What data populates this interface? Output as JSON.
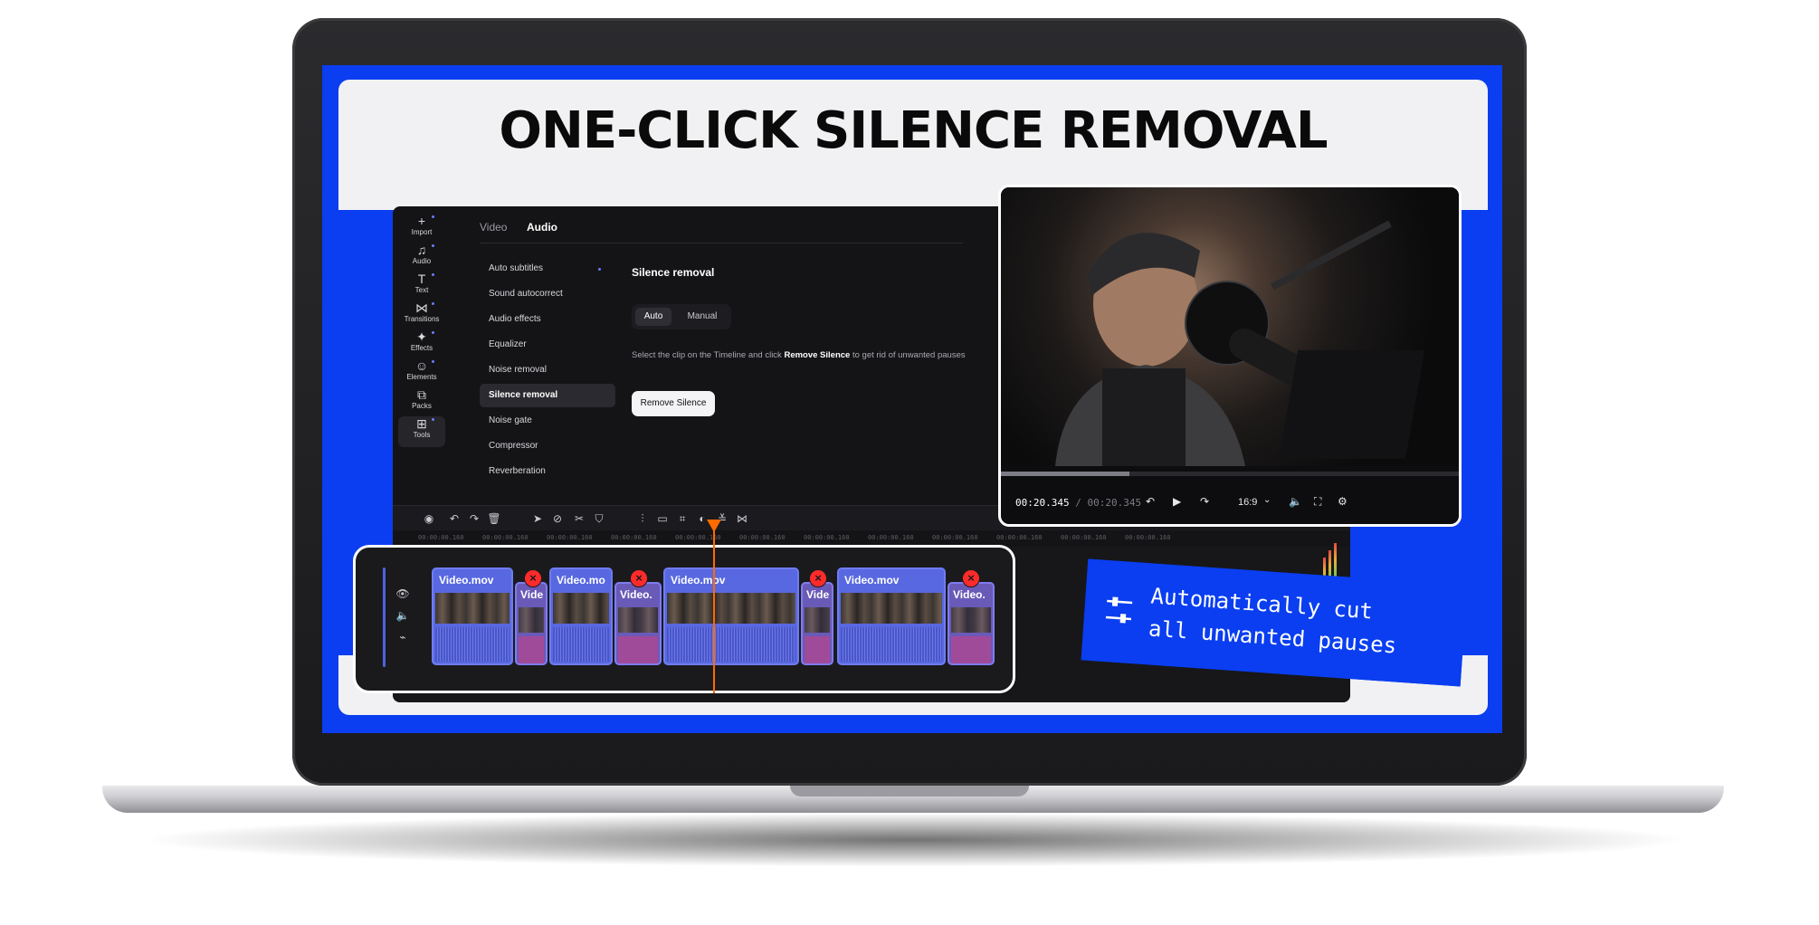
{
  "headline": "ONE-CLICK SILENCE REMOVAL",
  "rail": [
    {
      "label": "Import",
      "icon": "plus-icon"
    },
    {
      "label": "Audio",
      "icon": "music-note-icon"
    },
    {
      "label": "Text",
      "icon": "text-icon"
    },
    {
      "label": "Transitions",
      "icon": "transitions-icon"
    },
    {
      "label": "Effects",
      "icon": "effects-sparkle-icon"
    },
    {
      "label": "Elements",
      "icon": "smiley-icon"
    },
    {
      "label": "Packs",
      "icon": "packs-icon"
    },
    {
      "label": "Tools",
      "icon": "tools-grid-icon"
    }
  ],
  "tabs": {
    "video": "Video",
    "audio": "Audio"
  },
  "menu": [
    "Auto subtitles",
    "Sound autocorrect",
    "Audio effects",
    "Equalizer",
    "Noise removal",
    "Silence removal",
    "Noise gate",
    "Compressor",
    "Reverberation"
  ],
  "panel": {
    "title": "Silence removal",
    "mode_auto": "Auto",
    "mode_manual": "Manual",
    "instruction_pre": "Select the clip on the Timeline and click ",
    "instruction_bold": "Remove Silence",
    "instruction_post": " to get rid of unwanted pauses",
    "button": "Remove Silence"
  },
  "ruler_ticks": [
    "00:00:00.160",
    "00:00:00.160",
    "00:00:00.160",
    "00:00:00.160",
    "00:00:00.160",
    "00:00:00.160",
    "00:00:00.160",
    "00:00:00.160",
    "00:00:00.160",
    "00:00:00.160",
    "00:00:00.160",
    "00:00:00.160"
  ],
  "preview": {
    "time_current": "00:20.345",
    "time_sep": "/",
    "time_total": "00:20.345",
    "aspect": "16:9",
    "progress": 0.28
  },
  "clips": [
    {
      "label": "Video.mov",
      "kind": "keep"
    },
    {
      "label": "Vide",
      "kind": "cut"
    },
    {
      "label": "Video.mo",
      "kind": "keep"
    },
    {
      "label": "Video.",
      "kind": "cut"
    },
    {
      "label": "Video.mov",
      "kind": "keep"
    },
    {
      "label": "Vide",
      "kind": "cut"
    },
    {
      "label": "Video.mov",
      "kind": "keep"
    },
    {
      "label": "Video.",
      "kind": "cut"
    }
  ],
  "callout": {
    "line1": "Automatically cut",
    "line2": "all unwanted pauses"
  },
  "colors": {
    "brand_blue": "#0a3ef0",
    "clip": "#5868e0",
    "cut_marker": "#ff2b2b",
    "playhead": "#ff6a00"
  }
}
